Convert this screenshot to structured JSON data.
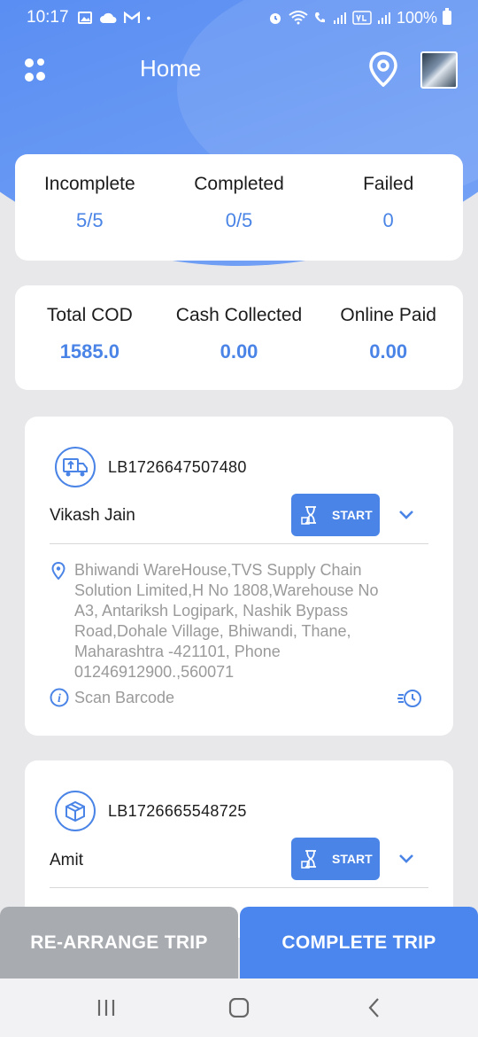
{
  "status_bar": {
    "time": "10:17",
    "dot": "•",
    "battery": "100%"
  },
  "header": {
    "title": "Home"
  },
  "stats_top": [
    {
      "label": "Incomplete",
      "value": "5/5"
    },
    {
      "label": "Completed",
      "value": "0/5"
    },
    {
      "label": "Failed",
      "value": "0"
    }
  ],
  "stats_cod": [
    {
      "label": "Total COD",
      "value": "1585.0"
    },
    {
      "label": "Cash Collected",
      "value": "0.00"
    },
    {
      "label": "Online Paid",
      "value": "0.00"
    }
  ],
  "trips": [
    {
      "id": "LB1726647507480",
      "name": "Vikash Jain",
      "start_label": "START",
      "address": "Bhiwandi WareHouse,TVS Supply Chain Solution Limited,H No 1808,Warehouse No A3, Antariksh Logipark, Nashik Bypass Road,Dohale Village, Bhiwandi, Thane, Maharashtra -421101, Phone 01246912900.,560071",
      "scan_label": "Scan Barcode"
    },
    {
      "id": "LB1726665548725",
      "name": "Amit",
      "start_label": "START"
    }
  ],
  "actions": {
    "rearrange": "RE-ARRANGE TRIP",
    "complete": "COMPLETE TRIP"
  },
  "colors": {
    "primary": "#4a84e6",
    "secondary_button": "#a8abb0"
  }
}
